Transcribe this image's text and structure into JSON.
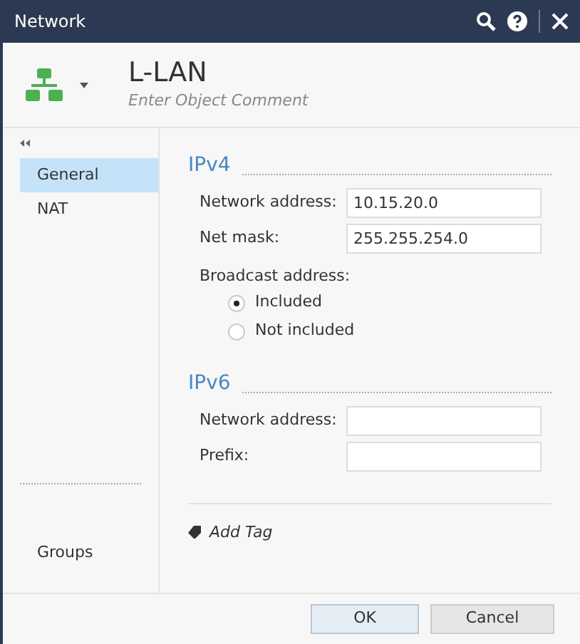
{
  "window": {
    "title": "Network"
  },
  "object": {
    "name": "L-LAN",
    "comment_placeholder": "Enter Object Comment"
  },
  "sidebar": {
    "items": [
      {
        "label": "General",
        "selected": true
      },
      {
        "label": "NAT",
        "selected": false
      }
    ],
    "bottom_items": [
      {
        "label": "Groups",
        "selected": false
      }
    ]
  },
  "sections": [
    {
      "title": "IPv4",
      "fields": [
        {
          "label": "Network address:",
          "value": "10.15.20.0"
        },
        {
          "label": "Net mask:",
          "value": "255.255.254.0"
        }
      ],
      "radio_group": {
        "label": "Broadcast address:",
        "options": [
          {
            "label": "Included",
            "selected": true
          },
          {
            "label": "Not included",
            "selected": false
          }
        ]
      }
    },
    {
      "title": "IPv6",
      "fields": [
        {
          "label": "Network address:"
        },
        {
          "label": "Prefix:"
        }
      ]
    }
  ],
  "add_tag": "Add Tag",
  "buttons": [
    {
      "label": "OK",
      "kind": "primary"
    },
    {
      "label": "Cancel",
      "kind": "secondary"
    }
  ]
}
